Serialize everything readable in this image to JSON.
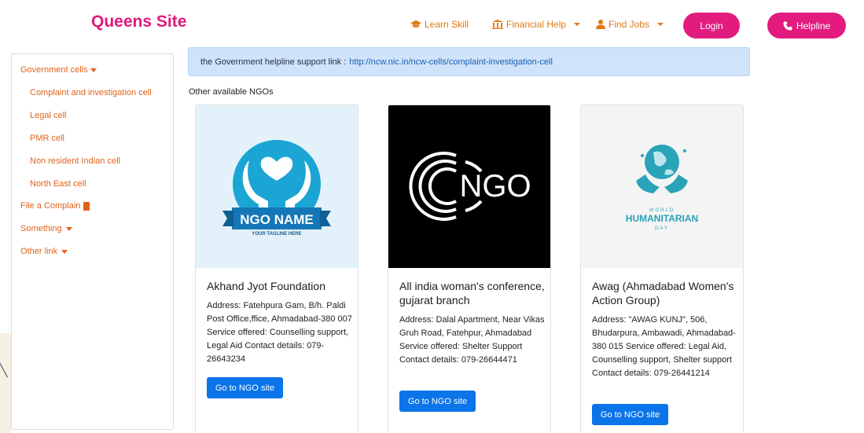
{
  "nav": {
    "brand": "Queens Site",
    "learn_skill": "Learn Skill",
    "financial_help": "Financial Help",
    "find_jobs": "Find Jobs",
    "login": "Login",
    "helpline": "Helpline"
  },
  "sidebar": {
    "government_cells": "Government cells",
    "items": [
      "Complaint and investigation cell",
      "Legal cell",
      "PMR cell",
      "Non resident Indian cell",
      "North East cell"
    ],
    "file_complain": "File a Complain",
    "something": "Something",
    "other_link": "Other link"
  },
  "alert": {
    "text": "the Government helpline support link :",
    "link": "http://ncw.nic.in/ncw-cells/complaint-investigation-cell"
  },
  "section_title": "Other available NGOs",
  "cards": [
    {
      "title": "Akhand Jyot Foundation",
      "text": "Address: Fatehpura Gam, B/h. Paldi Post Office,ffice, Ahmadabad-380 007 Service offered: Counselling support, Legal Aid Contact details: 079-26643234",
      "button": "Go to NGO site",
      "logo_main": "NGO NAME",
      "logo_sub": "YOUR TAGLINE HERE"
    },
    {
      "title": "All india woman's conference, gujarat branch",
      "text": "Address: Dalal Apartment, Near Vikas Gruh Road, Fatehpur, Ahmadabad Service offered: Shelter Support Contact details: 079-26644471",
      "button": "Go to NGO site",
      "logo_main": "NGO"
    },
    {
      "title": "Awag (Ahmadabad Women's Action Group)",
      "text": "Address: \"AWAG KUNJ\", 506, Bhudarpura, Ambawadi, Ahmadabad-380 015 Service offered: Legal Aid, Counselling support, Shelter support Contact details: 079-26441214",
      "button": "Go to NGO site",
      "logo_top": "WORLD",
      "logo_main": "HUMANITARIAN",
      "logo_bottom": "DAY"
    }
  ],
  "colors": {
    "brand_pink": "#e0197d",
    "nav_orange": "#e07a14",
    "sidebar_orange": "#e0631a",
    "button_blue": "#0b74e8",
    "alert_bg": "#cfe3fb"
  },
  "icons": [
    "graduation-cap-icon",
    "bank-icon",
    "user-tie-icon",
    "phone-icon",
    "file-icon",
    "caret-down-icon"
  ]
}
